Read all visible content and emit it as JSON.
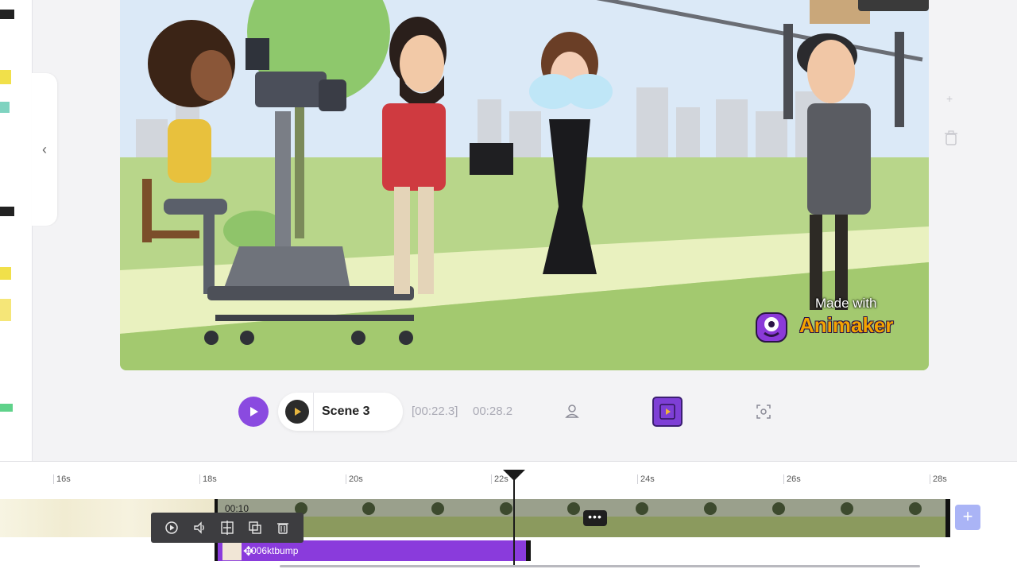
{
  "canvas": {
    "watermark_made": "Made with",
    "watermark_brand": "Animaker"
  },
  "controls": {
    "scene_label": "Scene 3",
    "time_current": "[00:22.3]",
    "time_total": "00:28.2"
  },
  "timeline": {
    "ticks": [
      "16s",
      "18s",
      "20s",
      "22s",
      "24s",
      "26s",
      "28s"
    ],
    "bg_duration": "00:10",
    "more_label": "•••",
    "add_label": "+",
    "char_item": "006ktbump"
  },
  "colors": {
    "accent": "#8a4ae0",
    "char_track": "#8a3bdc",
    "add_track": "#aab4f6",
    "watermark_brand": "#f3a300"
  },
  "icons": {
    "collapse": "chevron-left-icon",
    "toolbar": [
      "play-icon",
      "volume-icon",
      "split-icon",
      "duplicate-icon",
      "trash-icon"
    ]
  }
}
